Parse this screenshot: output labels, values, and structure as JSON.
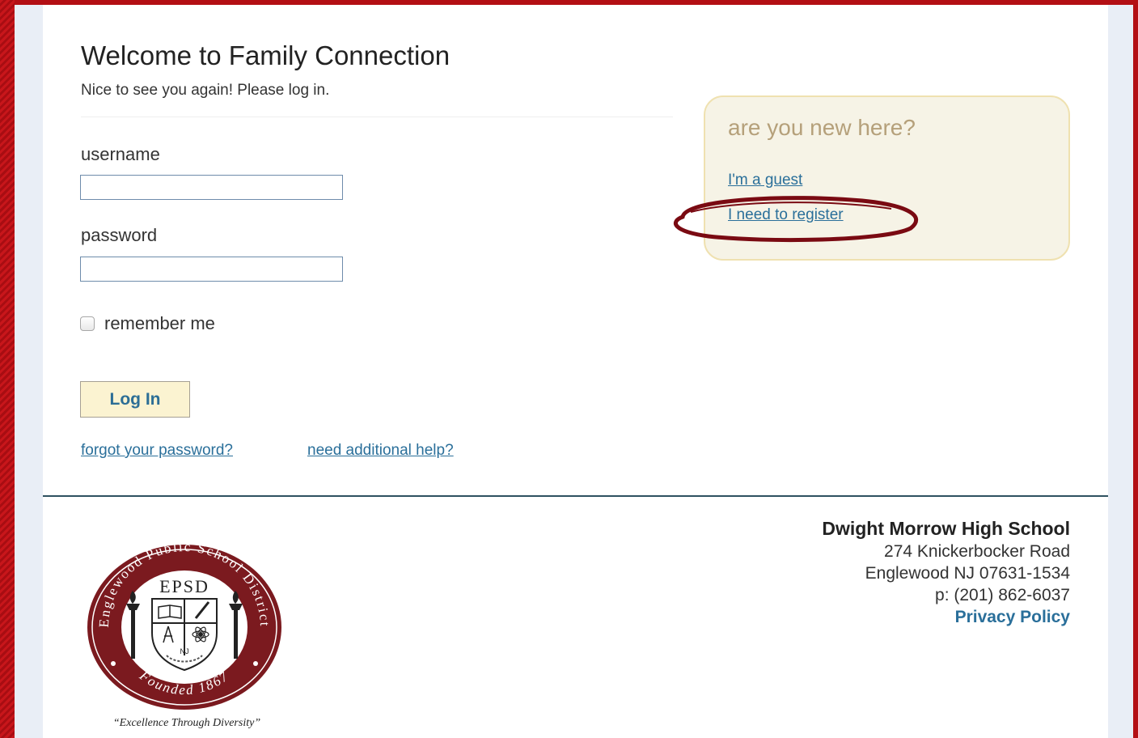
{
  "login": {
    "title": "Welcome to Family Connection",
    "subtitle": "Nice to see you again! Please log in.",
    "username_label": "username",
    "username_value": "",
    "password_label": "password",
    "password_value": "",
    "remember_label": "remember me",
    "remember_checked": false,
    "login_button": "Log In",
    "forgot_link": "forgot your password?",
    "help_link": "need additional help?"
  },
  "new_user": {
    "title": "are you new here?",
    "guest_link": "I'm a guest",
    "register_link": "I need to register",
    "annotation_color": "#7a0a12"
  },
  "footer": {
    "school_name": "Dwight Morrow High School",
    "street": "274 Knickerbocker Road",
    "city": "Englewood NJ 07631-1534",
    "phone": "p: (201) 862-6037",
    "privacy_link": "Privacy Policy"
  },
  "seal": {
    "ring_text": "Englewood Public School District",
    "initials": "EPSD",
    "state": "NJ",
    "founded": "Founded 1867",
    "motto": "“Excellence Through Diversity”"
  },
  "colors": {
    "frame": "#b30f14",
    "link": "#2a6f9a",
    "seal_red": "#7b1a1f",
    "box_bg": "#f6f3e6",
    "box_border": "#efe1b0",
    "button_bg": "#fbf3d1"
  }
}
